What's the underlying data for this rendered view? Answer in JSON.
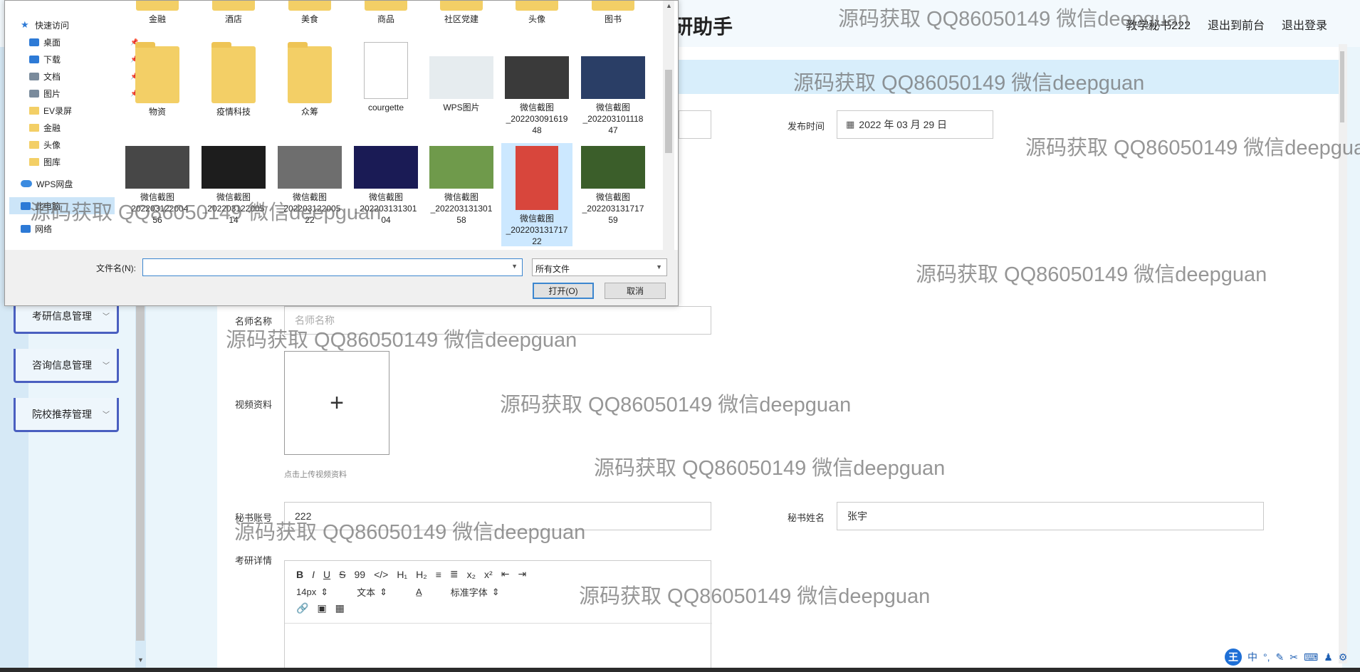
{
  "app": {
    "title": "研助手",
    "top_links": [
      "教学秘书222",
      "退出到前台",
      "退出登录"
    ],
    "sidebar_menus": [
      "考研信息管理",
      "咨询信息管理",
      "院校推荐管理"
    ]
  },
  "form": {
    "publish_time_label": "发布时间",
    "publish_time_value": "2022 年 03 月 29 日",
    "teacher_label": "名师名称",
    "teacher_placeholder": "名师名称",
    "video_label": "视频资料",
    "upload_plus": "+",
    "upload_hint": "点击上传视频资料",
    "secretary_account_label": "秘书账号",
    "secretary_account_value": "222",
    "secretary_name_label": "秘书姓名",
    "secretary_name_value": "张宇",
    "detail_label": "考研详情"
  },
  "editor": {
    "row1": [
      "B",
      "I",
      "U",
      "S",
      "99",
      "</>",
      "H₁",
      "H₂",
      "≡",
      "≣",
      "x₂",
      "x²",
      "⇤",
      "⇥"
    ],
    "font_size": "14px",
    "text_style": "文本",
    "font_family": "标准字体",
    "row3": [
      "🔗",
      "▣",
      "▦"
    ]
  },
  "watermark": "源码获取 QQ86050149 微信deepguan",
  "dialog": {
    "nav": [
      {
        "label": "快速访问",
        "icon": "star-icon"
      },
      {
        "label": "桌面",
        "icon": "desktop-icon",
        "pinned": true
      },
      {
        "label": "下载",
        "icon": "download-icon",
        "pinned": true
      },
      {
        "label": "文档",
        "icon": "document-icon",
        "pinned": true
      },
      {
        "label": "图片",
        "icon": "picture-icon",
        "pinned": true
      },
      {
        "label": "EV录屏",
        "icon": "folder-icon"
      },
      {
        "label": "金融",
        "icon": "folder-icon"
      },
      {
        "label": "头像",
        "icon": "folder-icon"
      },
      {
        "label": "图库",
        "icon": "folder-icon"
      },
      {
        "label": "WPS网盘",
        "icon": "cloud-icon"
      },
      {
        "label": "此电脑",
        "icon": "computer-icon"
      },
      {
        "label": "网络",
        "icon": "network-icon"
      }
    ],
    "row0": [
      "金融",
      "酒店",
      "美食",
      "商品",
      "社区党建",
      "头像",
      "图书"
    ],
    "row1": [
      {
        "label": "物资",
        "kind": "folder"
      },
      {
        "label": "疫情科技",
        "kind": "folder"
      },
      {
        "label": "众筹",
        "kind": "folder"
      },
      {
        "label": "courgette",
        "kind": "doc"
      },
      {
        "label": "WPS图片",
        "kind": "photo",
        "color": "#e6ecef"
      },
      {
        "label": "微信截图\n_202203091619\n48",
        "kind": "photo",
        "color": "#3a3a3a"
      },
      {
        "label": "微信截图\n_202203101118\n47",
        "kind": "photo",
        "color": "#2a3e66"
      }
    ],
    "row2": [
      {
        "label": "微信截图\n_202203122004\n56",
        "kind": "photo",
        "color": "#474747"
      },
      {
        "label": "微信截图\n_202203122005\n14",
        "kind": "photo",
        "color": "#1d1d1d"
      },
      {
        "label": "微信截图\n_202203122005\n22",
        "kind": "photo",
        "color": "#6e6e6e"
      },
      {
        "label": "微信截图\n_202203131301\n04",
        "kind": "photo",
        "color": "#1a1b55"
      },
      {
        "label": "微信截图\n_202203131301\n58",
        "kind": "photo",
        "color": "#6f9a4b"
      },
      {
        "label": "微信截图\n_202203131717\n22",
        "kind": "photo",
        "color": "#d8463c"
      },
      {
        "label": "微信截图\n_202203131717\n59",
        "kind": "photo",
        "color": "#3b5e2a"
      }
    ],
    "filename_label": "文件名(N):",
    "filename_value": "",
    "filetype": "所有文件",
    "open_label": "打开(O)",
    "cancel_label": "取消"
  }
}
